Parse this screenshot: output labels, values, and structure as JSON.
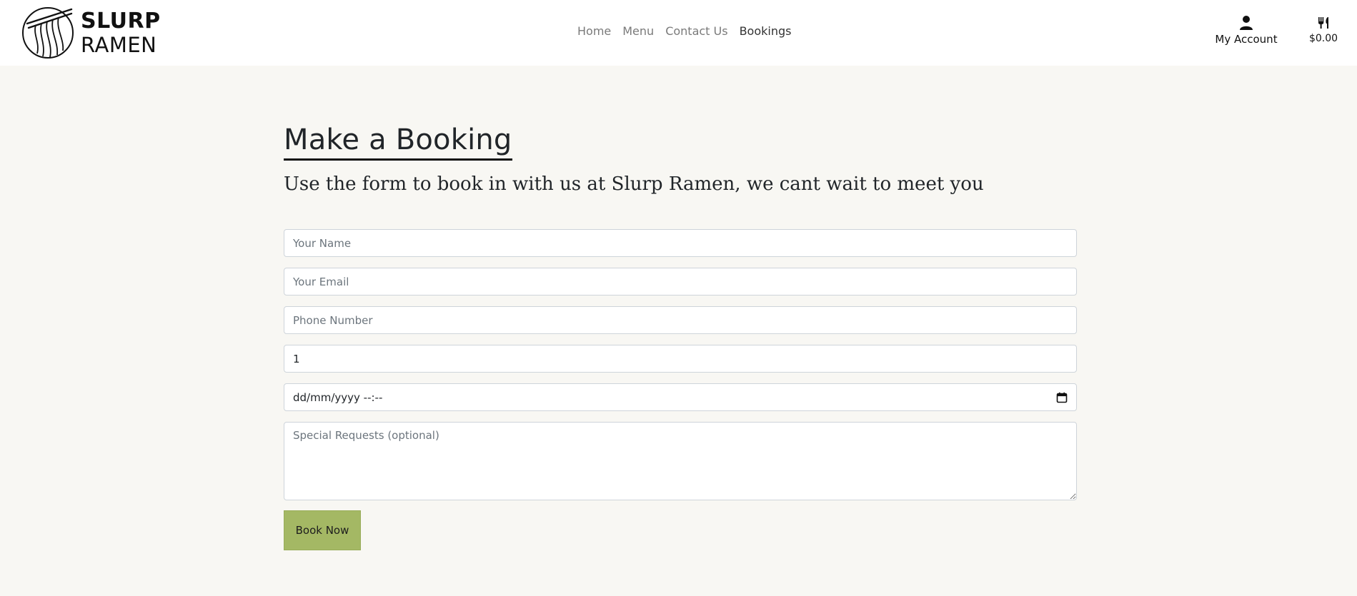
{
  "brand": {
    "name_top": "SLURP",
    "name_bottom": "RAMEN"
  },
  "nav": {
    "links": [
      {
        "label": "Home",
        "active": false
      },
      {
        "label": "Menu",
        "active": false
      },
      {
        "label": "Contact Us",
        "active": false
      },
      {
        "label": "Bookings",
        "active": true
      }
    ],
    "account_label": "My Account",
    "account_icon": "user-icon",
    "cart_total": "$0.00",
    "cart_icon": "utensils-icon"
  },
  "page": {
    "title": "Make a Booking",
    "subtitle": "Use the form to book in with us at Slurp Ramen, we cant wait to meet you"
  },
  "form": {
    "name_placeholder": "Your Name",
    "email_placeholder": "Your Email",
    "phone_placeholder": "Phone Number",
    "guests_value": "1",
    "datetime_value": "dd/mm/yyyy --:--",
    "datetime_icon": "calendar-icon",
    "requests_placeholder": "Special Requests (optional)",
    "submit_label": "Book Now"
  },
  "colors": {
    "page_background": "#f8f7f3",
    "header_background": "#ffffff",
    "button_background": "#a4b864",
    "text": "#212529",
    "nav_muted": "#7a7a7a"
  }
}
